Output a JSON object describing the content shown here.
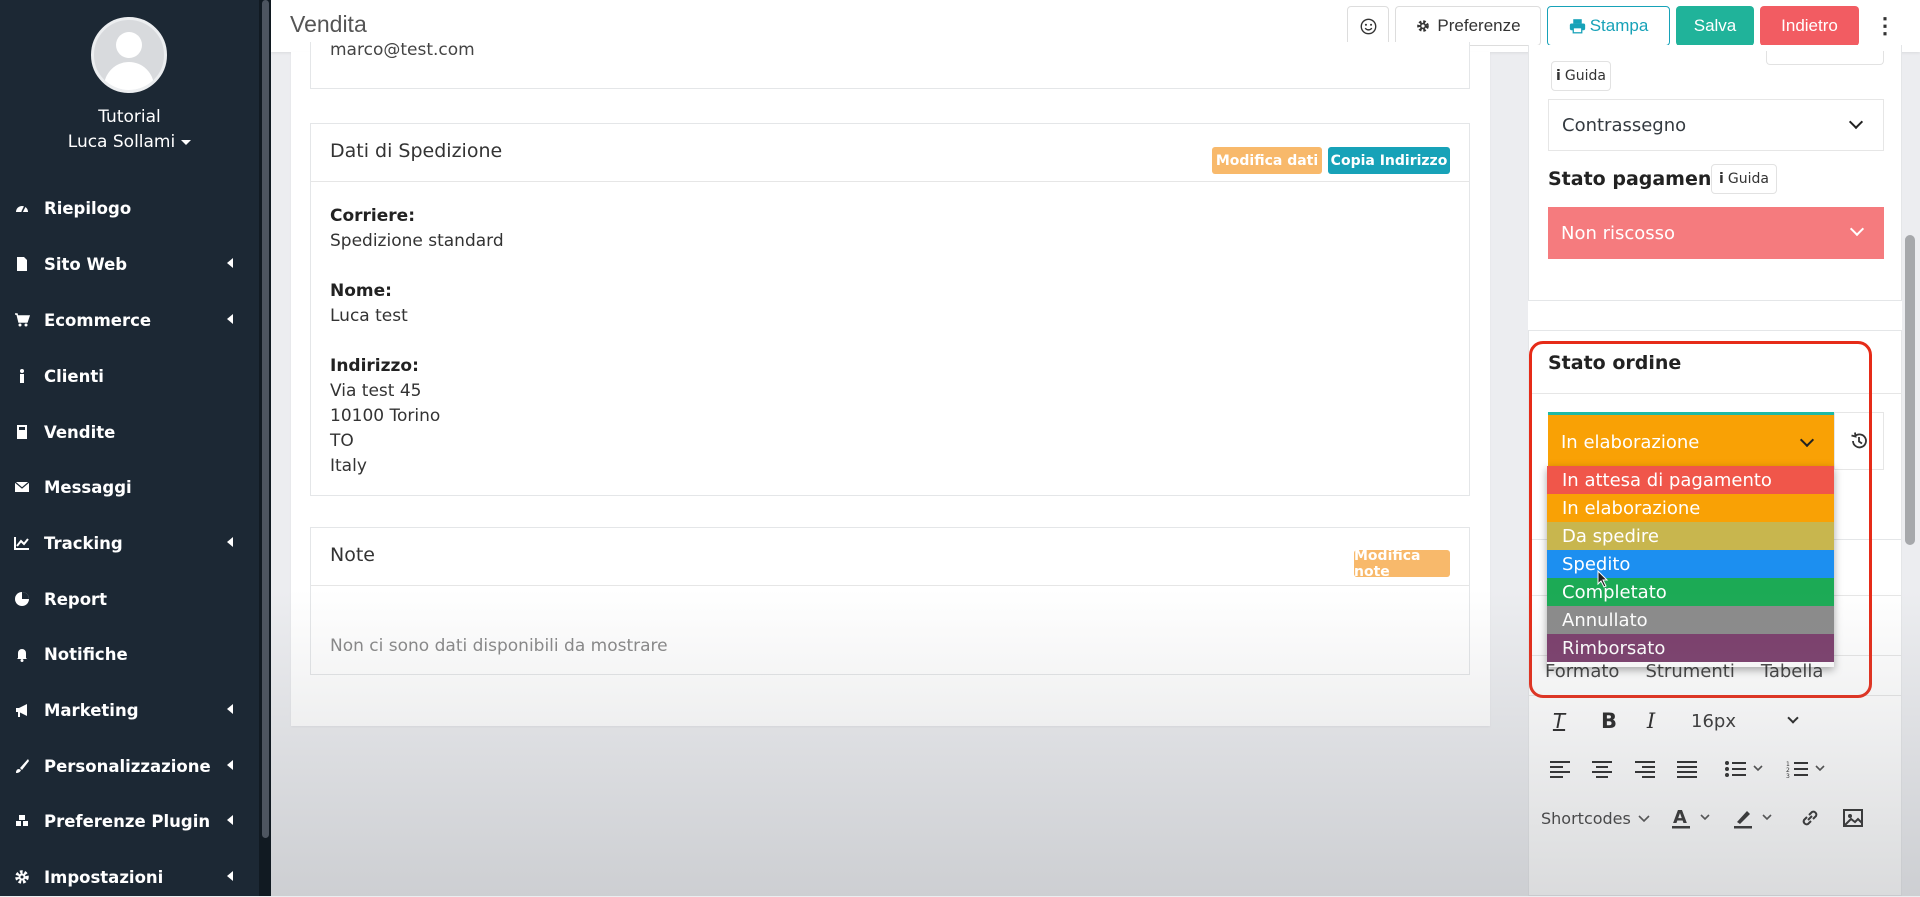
{
  "sidebar": {
    "user_org": "Tutorial",
    "user_name": "Luca Sollami",
    "items": [
      {
        "label": "Riepilogo",
        "icon": "dashboard-icon"
      },
      {
        "label": "Sito Web",
        "icon": "file-icon"
      },
      {
        "label": "Ecommerce",
        "icon": "cart-icon"
      },
      {
        "label": "Clienti",
        "icon": "person-icon"
      },
      {
        "label": "Vendite",
        "icon": "calculator-icon"
      },
      {
        "label": "Messaggi",
        "icon": "envelope-icon"
      },
      {
        "label": "Tracking",
        "icon": "line-chart-icon"
      },
      {
        "label": "Report",
        "icon": "pie-chart-icon"
      },
      {
        "label": "Notifiche",
        "icon": "bell-icon"
      },
      {
        "label": "Marketing",
        "icon": "bullhorn-icon"
      },
      {
        "label": "Personalizzazione",
        "icon": "brush-icon"
      },
      {
        "label": "Preferenze Plugin",
        "icon": "cubes-icon"
      },
      {
        "label": "Impostazioni",
        "icon": "gear-icon"
      }
    ]
  },
  "header": {
    "title": "Vendita",
    "preferenze": "Preferenze",
    "stampa": "Stampa",
    "salva": "Salva",
    "indietro": "Indietro",
    "more": "⋮",
    "colors": {
      "salva": "#20b39a",
      "indietro": "#f25c62",
      "stampa": "#17a2b8"
    }
  },
  "email_partial": "marco@test.com",
  "spedizione": {
    "title": "Dati di Spedizione",
    "modifica_dati": "Modifica dati",
    "copia_indirizzo": "Copia Indirizzo",
    "corriere_label": "Corriere:",
    "corriere_value": "Spedizione standard",
    "nome_label": "Nome:",
    "nome_value": "Luca test",
    "indirizzo_label": "Indirizzo:",
    "indirizzo_lines": [
      "Via test 45",
      "10100 Torino",
      "TO",
      "Italy"
    ]
  },
  "note": {
    "title": "Note",
    "modifica_note": "Modifica note",
    "empty_text": "Non ci sono dati disponibili da mostrare"
  },
  "right_panel": {
    "guida": "Guida",
    "metodo_pagamento_value": "Contrassegno",
    "stato_pagamento_label": "Stato pagamento",
    "stato_pagamento_value": "Non riscosso",
    "stato_ordine_label": "Stato ordine",
    "stato_ordine_value": "In elaborazione",
    "stato_ordine_options": [
      {
        "label": "In attesa di pagamento",
        "color": "#f0564a"
      },
      {
        "label": "In elaborazione",
        "color": "#f9a105"
      },
      {
        "label": "Da spedire",
        "color": "#c8b64e"
      },
      {
        "label": "Spedito",
        "color": "#1c8ff0"
      },
      {
        "label": "Completato",
        "color": "#1caa55"
      },
      {
        "label": "Annullato",
        "color": "#8b8b8b"
      },
      {
        "label": "Rimborsato",
        "color": "#7b3e6c"
      }
    ],
    "editor_menu": [
      "Formato",
      "Strumenti",
      "Tabella"
    ],
    "font_size": "16px",
    "shortcodes": "Shortcodes"
  }
}
